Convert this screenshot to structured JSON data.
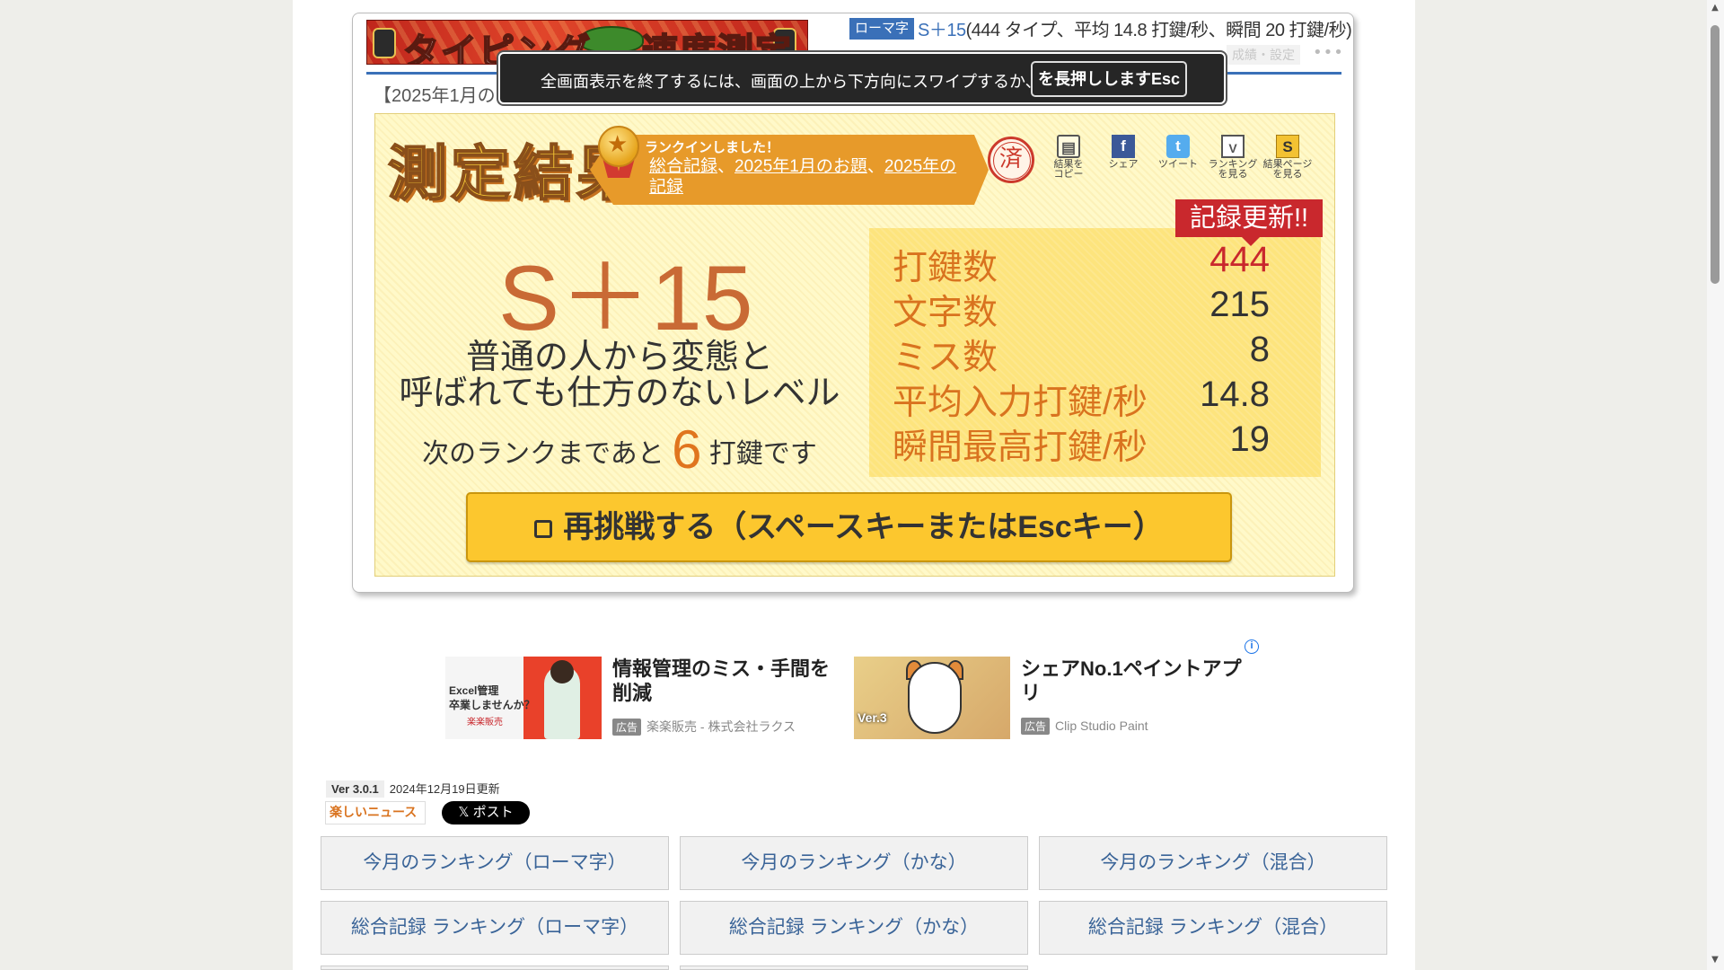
{
  "header": {
    "banner_text_1": "タイピング",
    "banner_text_2": "速度測定",
    "mode_badge": "ローマ字",
    "summary_rank": "S＋15",
    "summary_detail": "(444 タイプ、平均 14.8 打鍵/秒、瞬間 20 打鍵/秒)",
    "settings_label": "成績・設定",
    "more_label": "•••",
    "subtitle": "【2025年1月のお"
  },
  "fullscreen_toast": {
    "message": "全画面表示を終了するには、画面の上から下方向にスワイプするか、",
    "key_label": "を長押ししますEsc"
  },
  "result": {
    "title": "測定結果",
    "rankin_heading": "ランクインしました！",
    "rankin_links": [
      "総合記録",
      "2025年1月のお題",
      "2025年の記録"
    ],
    "rankin_sep": "、",
    "stamp": "済",
    "tools": [
      {
        "icon": "clipboard-icon",
        "glyph": "▤",
        "line1": "結果を",
        "line2": "コピー"
      },
      {
        "icon": "facebook-icon",
        "glyph": "f",
        "line1": "シェア",
        "line2": ""
      },
      {
        "icon": "twitter-icon",
        "glyph": "t",
        "line1": "ツイート",
        "line2": ""
      },
      {
        "icon": "ranking-icon",
        "glyph": "V",
        "line1": "ランキング",
        "line2": "を見る"
      },
      {
        "icon": "result-page-icon",
        "glyph": "S",
        "line1": "結果ページ",
        "line2": "を見る"
      }
    ],
    "record_badge": "記録更新!!",
    "grade": "S＋15",
    "level_line1": "普通の人から変態と",
    "level_line2": "呼ばれても仕方のないレベル",
    "next_prefix": "次のランクまであと",
    "next_count": "6",
    "next_suffix": "打鍵です",
    "stats": [
      {
        "label": "打鍵数",
        "value": "444",
        "highlight": true
      },
      {
        "label": "文字数",
        "value": "215",
        "highlight": false
      },
      {
        "label": "ミス数",
        "value": "8",
        "highlight": false
      },
      {
        "label": "平均入力打鍵/秒",
        "value": "14.8",
        "highlight": false
      },
      {
        "label": "瞬間最高打鍵/秒",
        "value": "19",
        "highlight": false
      }
    ],
    "retry_label": "再挑戦する（スペースキーまたはEscキー）"
  },
  "ads": [
    {
      "headline": "情報管理のミス・手間を削減",
      "tag": "広告",
      "source": "楽楽販売 - 株式会社ラクス",
      "thumb_text_1": "Excel管理",
      "thumb_text_2": "卒業しませんか？",
      "thumb_logo": "楽楽販売"
    },
    {
      "headline": "シェアNo.1ペイントアプリ",
      "tag": "広告",
      "source": "Clip Studio Paint",
      "thumb_text_1": "Ver.3"
    }
  ],
  "ad_info": "i",
  "footer": {
    "version": "Ver 3.0.1",
    "updated": "2024年12月19日更新",
    "news_logo": "楽しいニュース",
    "x_post": "𝕏 ポスト"
  },
  "nav": [
    "今月のランキング（ローマ字）",
    "今月のランキング（かな）",
    "今月のランキング（混合）",
    "総合記録 ランキング（ローマ字）",
    "総合記録 ランキング（かな）",
    "総合記録 ランキング（混合）"
  ]
}
